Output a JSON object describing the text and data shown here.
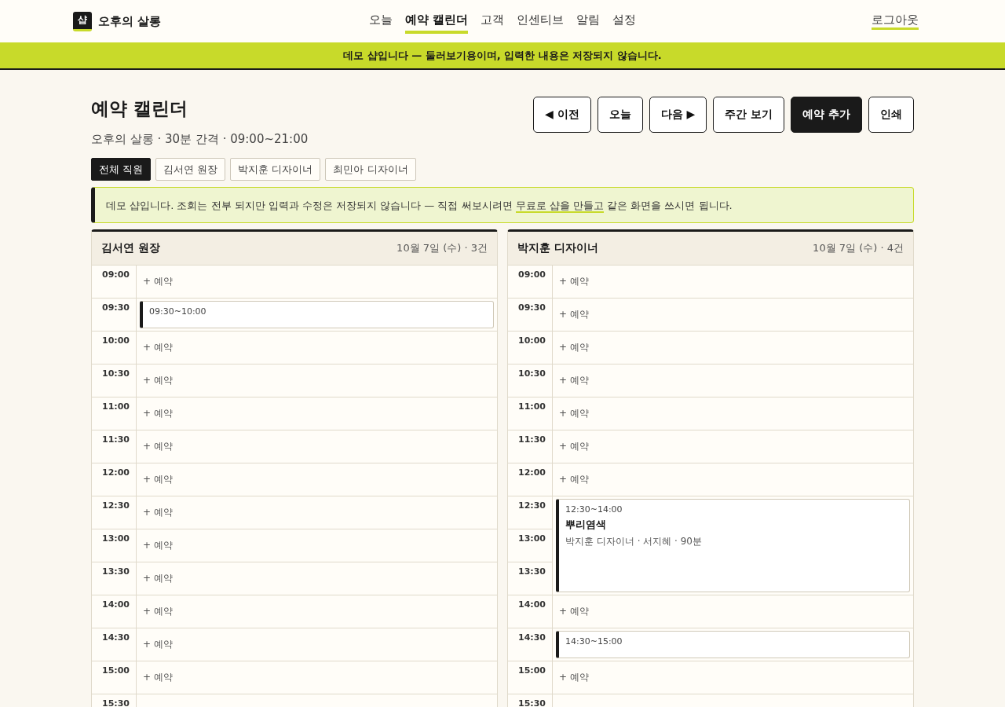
{
  "brand": {
    "logo": "샵",
    "name": "오후의 살롱"
  },
  "nav": [
    {
      "label": "오늘",
      "selected": false
    },
    {
      "label": "예약 캘린더",
      "selected": true
    },
    {
      "label": "고객",
      "selected": false
    },
    {
      "label": "인센티브",
      "selected": false
    },
    {
      "label": "알림",
      "selected": false
    },
    {
      "label": "설정",
      "selected": false
    }
  ],
  "logout": "로그아웃",
  "demo_banner": "데모 샵입니다 — 둘러보기용이며, 입력한 내용은 저장되지 않습니다.",
  "page": {
    "title": "예약 캘린더",
    "subtitle": "오후의 살롱 · 30분 간격 · 09:00~21:00"
  },
  "actions": [
    {
      "label": "◀ 이전",
      "kind": "default"
    },
    {
      "label": "오늘",
      "kind": "default"
    },
    {
      "label": "다음 ▶",
      "kind": "default"
    },
    {
      "label": "주간 보기",
      "kind": "default"
    },
    {
      "label": "예약 추가",
      "kind": "primary"
    },
    {
      "label": "인쇄",
      "kind": "default"
    }
  ],
  "staff_filter": [
    {
      "label": "전체 직원",
      "selected": true
    },
    {
      "label": "김서연 원장",
      "selected": false
    },
    {
      "label": "박지훈 디자이너",
      "selected": false
    },
    {
      "label": "최민아 디자이너",
      "selected": false
    }
  ],
  "notice": {
    "before": "데모 샵입니다. 조회는 전부 되지만 입력과 수정은 저장되지 않습니다 — 직접 써보시려면",
    "link": "무료로 샵을 만들고",
    "after": "같은 화면을 쓰시면 됩니다."
  },
  "columns": [
    {
      "name": "김서연 원장",
      "summary": "10월 7일 (수) · 3건",
      "slots": [
        {
          "time": "09:00",
          "kind": "open",
          "add": "+ 예약"
        },
        {
          "time": "09:30",
          "kind": "booking",
          "range": "09:30~10:00"
        },
        {
          "time": "10:00",
          "kind": "open",
          "add": "+ 예약"
        },
        {
          "time": "10:30",
          "kind": "open",
          "add": "+ 예약"
        },
        {
          "time": "11:00",
          "kind": "open",
          "add": "+ 예약"
        },
        {
          "time": "11:30",
          "kind": "open",
          "add": "+ 예약"
        },
        {
          "time": "12:00",
          "kind": "open",
          "add": "+ 예약"
        },
        {
          "time": "12:30",
          "kind": "open",
          "add": "+ 예약"
        },
        {
          "time": "13:00",
          "kind": "open",
          "add": "+ 예약"
        },
        {
          "time": "13:30",
          "kind": "open",
          "add": "+ 예약"
        },
        {
          "time": "14:00",
          "kind": "open",
          "add": "+ 예약"
        },
        {
          "time": "14:30",
          "kind": "open",
          "add": "+ 예약"
        },
        {
          "time": "15:00",
          "kind": "open",
          "add": "+ 예약"
        },
        {
          "time": "15:30",
          "kind": "open"
        }
      ]
    },
    {
      "name": "박지훈 디자이너",
      "summary": "10월 7일 (수) · 4건",
      "slots": [
        {
          "time": "09:00",
          "kind": "open",
          "add": "+ 예약"
        },
        {
          "time": "09:30",
          "kind": "open",
          "add": "+ 예약"
        },
        {
          "time": "10:00",
          "kind": "open",
          "add": "+ 예약"
        },
        {
          "time": "10:30",
          "kind": "open",
          "add": "+ 예약"
        },
        {
          "time": "11:00",
          "kind": "open",
          "add": "+ 예약"
        },
        {
          "time": "11:30",
          "kind": "open",
          "add": "+ 예약"
        },
        {
          "time": "12:00",
          "kind": "open",
          "add": "+ 예약"
        },
        {
          "time": "12:30",
          "kind": "booking",
          "range": "12:30~14:00",
          "title": "뿌리염색",
          "detail": "박지훈 디자이너 · 서지혜 · 90분"
        },
        {
          "time": "13:00",
          "kind": "continued"
        },
        {
          "time": "13:30",
          "kind": "continued"
        },
        {
          "time": "14:00",
          "kind": "open",
          "add": "+ 예약"
        },
        {
          "time": "14:30",
          "kind": "booking",
          "range": "14:30~15:00"
        },
        {
          "time": "15:00",
          "kind": "open",
          "add": "+ 예약"
        },
        {
          "time": "15:30",
          "kind": "open"
        }
      ]
    }
  ]
}
